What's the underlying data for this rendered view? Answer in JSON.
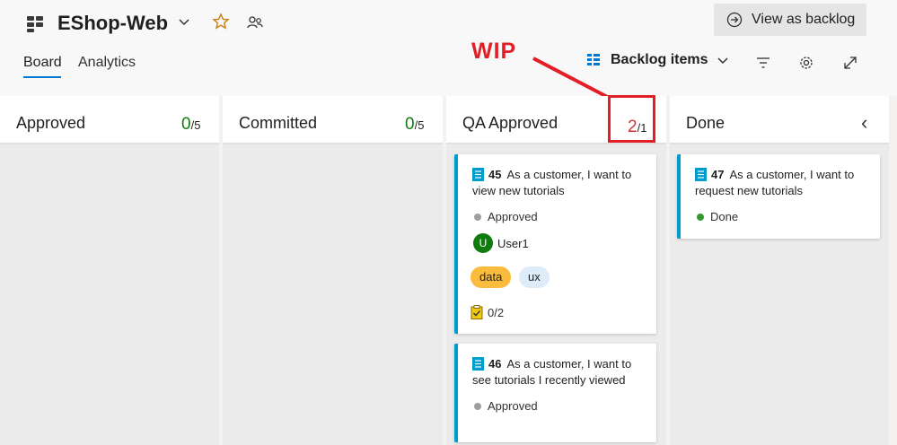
{
  "header": {
    "project_name": "EShop-Web",
    "view_backlog_label": "View as backlog",
    "tabs": [
      {
        "label": "Board",
        "active": true
      },
      {
        "label": "Analytics",
        "active": false
      }
    ],
    "backlog_selector": "Backlog items",
    "icons": [
      "boards-icon",
      "chevron-down-icon",
      "favorite-star-icon",
      "team-icon",
      "filter-icon",
      "settings-gear-icon",
      "fullscreen-icon"
    ]
  },
  "annotation": {
    "label": "WIP",
    "color": "#e21f26"
  },
  "columns": [
    {
      "title": "Approved",
      "count": "0",
      "limit": "/5",
      "count_color": "#107c10"
    },
    {
      "title": "Committed",
      "count": "0",
      "limit": "/5",
      "count_color": "#107c10"
    },
    {
      "title": "QA Approved",
      "count": "2",
      "limit": "/1",
      "count_color": "#d13438"
    },
    {
      "title": "Done",
      "collapse": "‹"
    }
  ],
  "cards": [
    {
      "id": "45",
      "title": "As a customer, I want to view new tutorials",
      "state": "Approved",
      "state_color": "#a19f9d",
      "assignee": "User1",
      "avatar_initial": "U",
      "tags": [
        "data",
        "ux"
      ],
      "tasks": "0/2"
    },
    {
      "id": "46",
      "title": "As a customer, I want to see tutorials I recently viewed",
      "state": "Approved",
      "state_color": "#a19f9d"
    },
    {
      "id": "47",
      "title": "As a customer, I want to request new tutorials",
      "state": "Done",
      "state_color": "#339933"
    }
  ],
  "colors": {
    "accent": "#0078d4",
    "card_border": "#009ccc",
    "tag_data": "#fbbc3d",
    "tag_ux": "#deecf9"
  }
}
